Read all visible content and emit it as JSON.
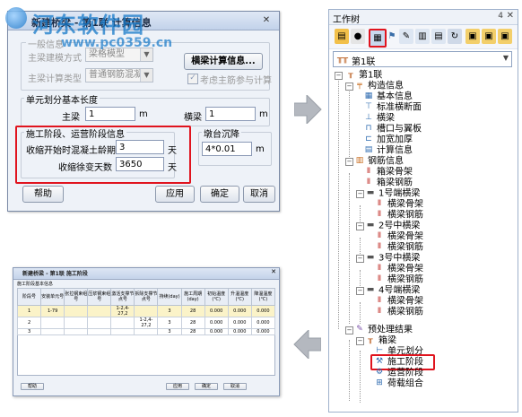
{
  "watermark": {
    "text": "河东软件园",
    "url": "www.pc0359.cn"
  },
  "dialog_calc": {
    "title": "新建桥梁 - 第1联 计算信息",
    "close": "✕",
    "group_basic": "一般信息",
    "main_beam_method_label": "主梁建模方式",
    "main_beam_method_value": "梁格模型",
    "main_beam_type_label": "主梁计算类型",
    "main_beam_type_value": "普通钢筋混凝土",
    "beam_calc_button": "横梁计算信息...",
    "main_rebar_check_label": "考虑主筋参与计算",
    "group_unit": "单元划分基本长度",
    "main_beam_label": "主梁",
    "main_beam_value": "1",
    "main_beam_unit": "m",
    "cross_beam_label": "横梁",
    "cross_beam_value": "1",
    "cross_beam_unit": "m",
    "group_stage": "施工阶段、运营阶段信息",
    "shrink_start_label": "收缩开始时混凝土龄期",
    "shrink_start_value": "3",
    "shrink_start_unit": "天",
    "creep_days_label": "收缩徐变天数",
    "creep_days_value": "3650",
    "creep_days_unit": "天",
    "group_settle": "墩台沉降",
    "settle_value": "4*0.01",
    "settle_unit": "m",
    "help": "帮助",
    "apply": "应用",
    "ok": "确定",
    "cancel": "取消"
  },
  "work_tree": {
    "title": "工作树",
    "pin": "4",
    "close": "✕",
    "selector_value": "第1联",
    "nodes": {
      "root": "第1联",
      "structure_info": "构造信息",
      "basic_info": "基本信息",
      "std_cross_section": "标准横断面",
      "cross_beam": "横梁",
      "slot_and_wall": "槽口与翼板",
      "haunch": "加宽加厚",
      "calc_info": "计算信息",
      "rebar_info": "钢筋信息",
      "box_skeleton": "箱梁骨架",
      "box_rebar": "箱梁钢筋",
      "end_beam_1": "1号端横梁",
      "eb1_skeleton": "横梁骨架",
      "eb1_rebar": "横梁钢筋",
      "mid_beam_2": "2号中横梁",
      "mb2_skeleton": "横梁骨架",
      "mb2_rebar": "横梁钢筋",
      "mid_beam_3": "3号中横梁",
      "mb3_skeleton": "横梁骨架",
      "mb3_rebar": "横梁钢筋",
      "end_beam_4": "4号端横梁",
      "eb4_skeleton": "横梁骨架",
      "eb4_rebar": "横梁钢筋",
      "preprocess": "预处理结果",
      "box": "箱梁",
      "unit_division": "单元划分",
      "construction_stage": "施工阶段",
      "operation_stage": "运营阶段",
      "load_combo": "荷载组合"
    }
  },
  "dialog_stage": {
    "title": "新建桥梁 - 第1联 施工阶段",
    "group": "施工阶段基本信息",
    "columns": [
      "阶段号",
      "安装单元号",
      "张拉钢束组号",
      "压浆钢束组号",
      "激活支撑节点号",
      "拆除支撑节点号",
      "持续(day)",
      "施工周期(day)",
      "初始温度(℃)",
      "升温温度(℃)",
      "降温温度(℃)"
    ],
    "rows": [
      [
        "1",
        "1-79",
        "",
        "",
        "1-2,4-27,2",
        "",
        "3",
        "28",
        "0.000",
        "0.000",
        "0.000"
      ],
      [
        "2",
        "",
        "",
        "",
        "",
        "1-2,4-27,2",
        "3",
        "28",
        "0.000",
        "0.000",
        "0.000"
      ],
      [
        "3",
        "",
        "",
        "",
        "",
        "",
        "3",
        "28",
        "0.000",
        "0.000",
        "0.000"
      ]
    ],
    "help": "帮助",
    "apply": "应用",
    "ok": "确定",
    "cancel": "取消"
  },
  "colors": {
    "highlight_red": "#e0141e",
    "arrow_grey": "#b4b8bf",
    "accent_blue": "#1f78c8"
  }
}
